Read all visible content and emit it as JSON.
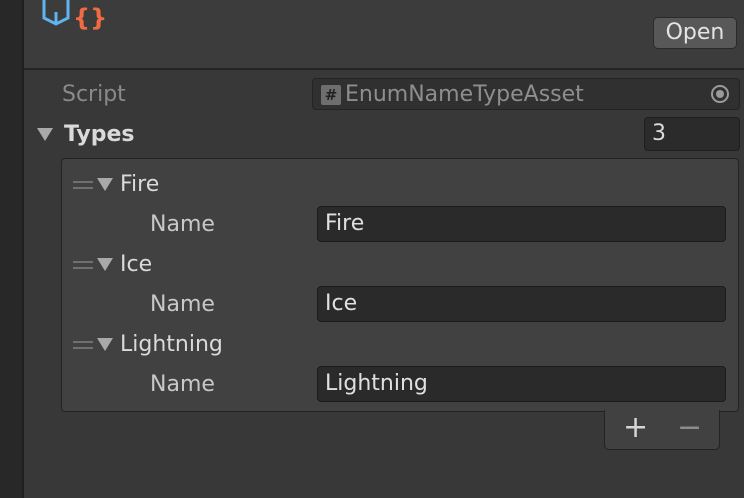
{
  "header": {
    "open_label": "Open"
  },
  "script": {
    "label": "Script",
    "value": "EnumNameTypeAsset",
    "hash_glyph": "#"
  },
  "types": {
    "label": "Types",
    "count": "3",
    "items": [
      {
        "label": "Fire",
        "field_label": "Name",
        "name": "Fire"
      },
      {
        "label": "Ice",
        "field_label": "Name",
        "name": "Ice"
      },
      {
        "label": "Lightning",
        "field_label": "Name",
        "name": "Lightning"
      }
    ],
    "add_label": "+",
    "remove_label": "−"
  },
  "colors": {
    "background": "#383838",
    "field": "#2a2a2a",
    "icon_blue": "#5fb3ee",
    "icon_orange": "#f06b43"
  }
}
